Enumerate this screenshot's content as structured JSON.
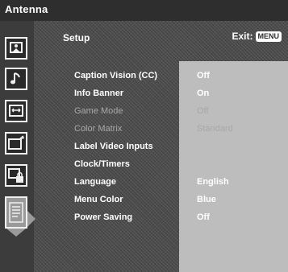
{
  "window": {
    "title": "Antenna"
  },
  "header": {
    "section_title": "Setup",
    "exit_label": "Exit:",
    "exit_key": "MENU"
  },
  "sidebar": {
    "icons": [
      {
        "name": "picture-icon"
      },
      {
        "name": "music-note-icon"
      },
      {
        "name": "screen-size-icon"
      },
      {
        "name": "channel-icon"
      },
      {
        "name": "parental-lock-icon"
      },
      {
        "name": "setup-icon",
        "active": true
      }
    ]
  },
  "menu": {
    "items": [
      {
        "label": "Caption Vision (CC)",
        "value": "Off",
        "enabled": true
      },
      {
        "label": "Info Banner",
        "value": "On",
        "enabled": true
      },
      {
        "label": "Game Mode",
        "value": "Off",
        "enabled": false
      },
      {
        "label": "Color Matrix",
        "value": "Standard",
        "enabled": false
      },
      {
        "label": "Label Video Inputs",
        "value": "",
        "enabled": true
      },
      {
        "label": "Clock/Timers",
        "value": "",
        "enabled": true
      },
      {
        "label": "Language",
        "value": "English",
        "enabled": true
      },
      {
        "label": "Menu Color",
        "value": "Blue",
        "enabled": true
      },
      {
        "label": "Power Saving",
        "value": "Off",
        "enabled": true
      }
    ]
  },
  "colors": {
    "background": "#4b4b4b",
    "title_bar": "#2e2e2e",
    "values_panel": "#bdbdbd",
    "text": "#ffffff",
    "disabled_text": "#a8a8a8"
  }
}
